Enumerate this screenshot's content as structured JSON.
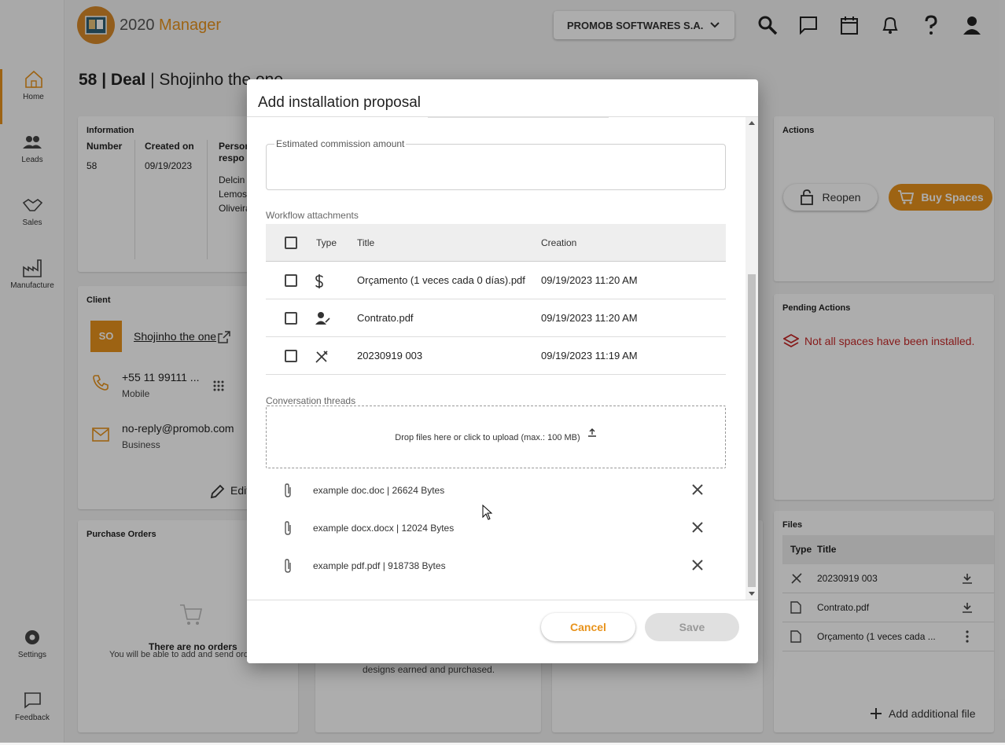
{
  "app": {
    "logo_a": "2020",
    "logo_b": " Manager",
    "company": "PROMOB SOFTWARES S.A."
  },
  "nav": [
    {
      "label": "Home"
    },
    {
      "label": "Leads"
    },
    {
      "label": "Sales"
    },
    {
      "label": "Manufacture"
    },
    {
      "label": "Settings"
    },
    {
      "label": "Feedback"
    }
  ],
  "deal": {
    "id": "58 | Deal",
    "name": " | Shojinho the one"
  },
  "information": {
    "title": "Information",
    "number_label": "Number",
    "number": "58",
    "created_label": "Created on",
    "created": "09/19/2023",
    "person_label1": "Person",
    "person_label2": "respo",
    "person1": "Delcin",
    "person2": "Lemos",
    "person3": "Oliveira"
  },
  "client": {
    "title": "Client",
    "initials": "SO",
    "name": "Shojinho the one",
    "phone": "+55 11 99111 ...",
    "phone_type": "Mobile",
    "email": "no-reply@promob.com",
    "email_type": "Business",
    "edit": "Edit"
  },
  "purchase_orders": {
    "title": "Purchase Orders",
    "empty": "There are no orders",
    "hint": "You will be able to add and send order"
  },
  "middle_note": "designs earned and purchased.",
  "actions": {
    "title": "Actions",
    "reopen": "Reopen",
    "buy": "Buy Spaces"
  },
  "pending": {
    "title": "Pending Actions",
    "message": "Not all spaces have been installed."
  },
  "files_card": {
    "title": "Files",
    "col_type": "Type",
    "col_title": "Title",
    "rows": [
      {
        "title": "20230919 003"
      },
      {
        "title": "Contrato.pdf"
      },
      {
        "title": "Orçamento (1 veces cada ..."
      }
    ],
    "add": "Add additional file"
  },
  "modal": {
    "title": "Add installation proposal",
    "commission_label": "Estimated commission amount",
    "attachments_label": "Workflow attachments",
    "cols": {
      "type": "Type",
      "title": "Title",
      "creation": "Creation"
    },
    "attachments": [
      {
        "title": "Orçamento (1 veces cada 0 días).pdf",
        "creation": "09/19/2023 11:20 AM"
      },
      {
        "title": "Contrato.pdf",
        "creation": "09/19/2023 11:20 AM"
      },
      {
        "title": "20230919 003",
        "creation": "09/19/2023 11:19 AM"
      }
    ],
    "threads_label": "Conversation threads",
    "dropzone": "Drop files here or click to upload (max.: 100 MB)",
    "files": [
      {
        "name": "example doc.doc | 26624 Bytes"
      },
      {
        "name": "example docx.docx | 12024 Bytes"
      },
      {
        "name": "example pdf.pdf | 918738 Bytes"
      }
    ],
    "cancel": "Cancel",
    "save": "Save"
  },
  "colors": {
    "accent": "#e8931c",
    "danger": "#c62828"
  }
}
